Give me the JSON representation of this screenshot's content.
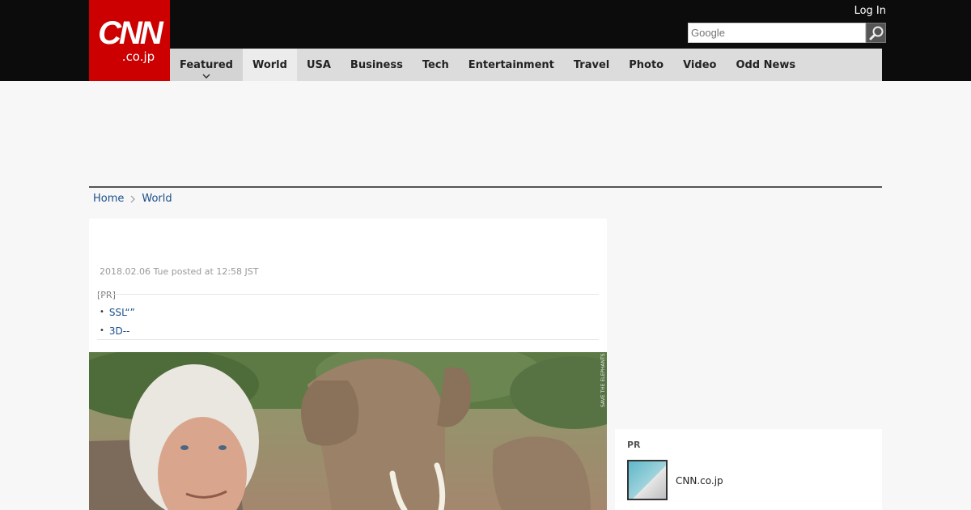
{
  "header": {
    "logo_main": "CNN",
    "logo_sub": ".co.jp",
    "login": "Log In",
    "search": {
      "placeholder": "Google"
    }
  },
  "nav": {
    "items": [
      {
        "label": "Featured"
      },
      {
        "label": "World"
      },
      {
        "label": "USA"
      },
      {
        "label": "Business"
      },
      {
        "label": "Tech"
      },
      {
        "label": "Entertainment"
      },
      {
        "label": "Travel"
      },
      {
        "label": "Photo"
      },
      {
        "label": "Video"
      },
      {
        "label": "Odd News"
      }
    ],
    "active": "World"
  },
  "breadcrumb": {
    "home": "Home",
    "current": "World"
  },
  "article": {
    "posted": "2018.02.06 Tue posted at 12:58 JST",
    "pr_label": "[PR]",
    "pr_links": [
      "SSL“”",
      "3D--"
    ],
    "photo_credit": "SAVE THE ELEPHANTS"
  },
  "sidebar": {
    "pr_head": "PR",
    "pr_item": "CNN.co.jp"
  },
  "colors": {
    "brand_red": "#cc0000",
    "link": "#1a4e8a",
    "nav_bg": "#dcdcdc"
  }
}
